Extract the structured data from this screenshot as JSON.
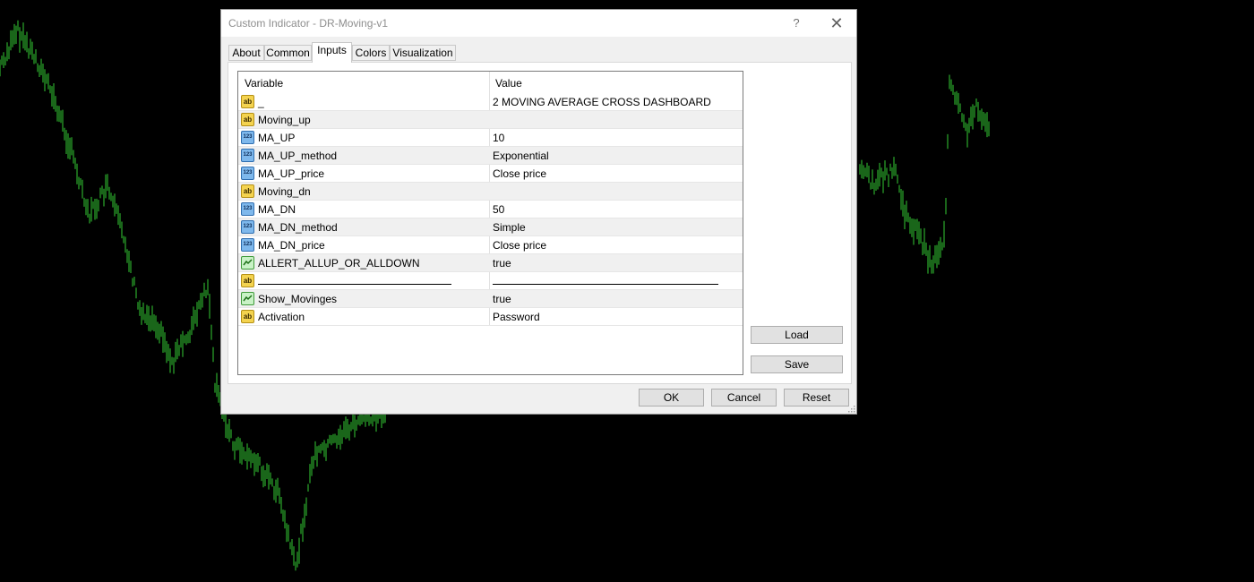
{
  "dialog": {
    "title": "Custom Indicator - DR-Moving-v1",
    "help_glyph": "?",
    "close_glyph": "✕"
  },
  "tabs": [
    {
      "label": "About"
    },
    {
      "label": "Common"
    },
    {
      "label": "Inputs",
      "active": true
    },
    {
      "label": "Colors"
    },
    {
      "label": "Visualization"
    }
  ],
  "grid": {
    "columns": {
      "variable": "Variable",
      "value": "Value"
    },
    "rows": [
      {
        "type": "ab",
        "name": "_",
        "value": "2 MOVING AVERAGE CROSS DASHBOARD"
      },
      {
        "type": "ab",
        "name": "Moving_up",
        "value": ""
      },
      {
        "type": "123",
        "name": "MA_UP",
        "value": "10"
      },
      {
        "type": "123",
        "name": "MA_UP_method",
        "value": "Exponential"
      },
      {
        "type": "123",
        "name": "MA_UP_price",
        "value": "Close price"
      },
      {
        "type": "ab",
        "name": "Moving_dn",
        "value": ""
      },
      {
        "type": "123",
        "name": "MA_DN",
        "value": "50"
      },
      {
        "type": "123",
        "name": "MA_DN_method",
        "value": "Simple"
      },
      {
        "type": "123",
        "name": "MA_DN_price",
        "value": "Close price"
      },
      {
        "type": "bool",
        "name": "ALLERT_ALLUP_OR_ALLDOWN",
        "value": "true"
      },
      {
        "type": "ab",
        "name": "",
        "value": "",
        "separator": true
      },
      {
        "type": "bool",
        "name": "Show_Movinges",
        "value": "true"
      },
      {
        "type": "ab",
        "name": "Activation",
        "value": "Password"
      }
    ]
  },
  "side_buttons": {
    "load": "Load",
    "save": "Save"
  },
  "footer_buttons": {
    "ok": "OK",
    "cancel": "Cancel",
    "reset": "Reset"
  },
  "icons": {
    "ab": "ab",
    "n123": "123"
  },
  "colors": {
    "chart_background": "#000000",
    "chart_bars": "#33cc33",
    "dialog_face": "#f0f0f0"
  }
}
